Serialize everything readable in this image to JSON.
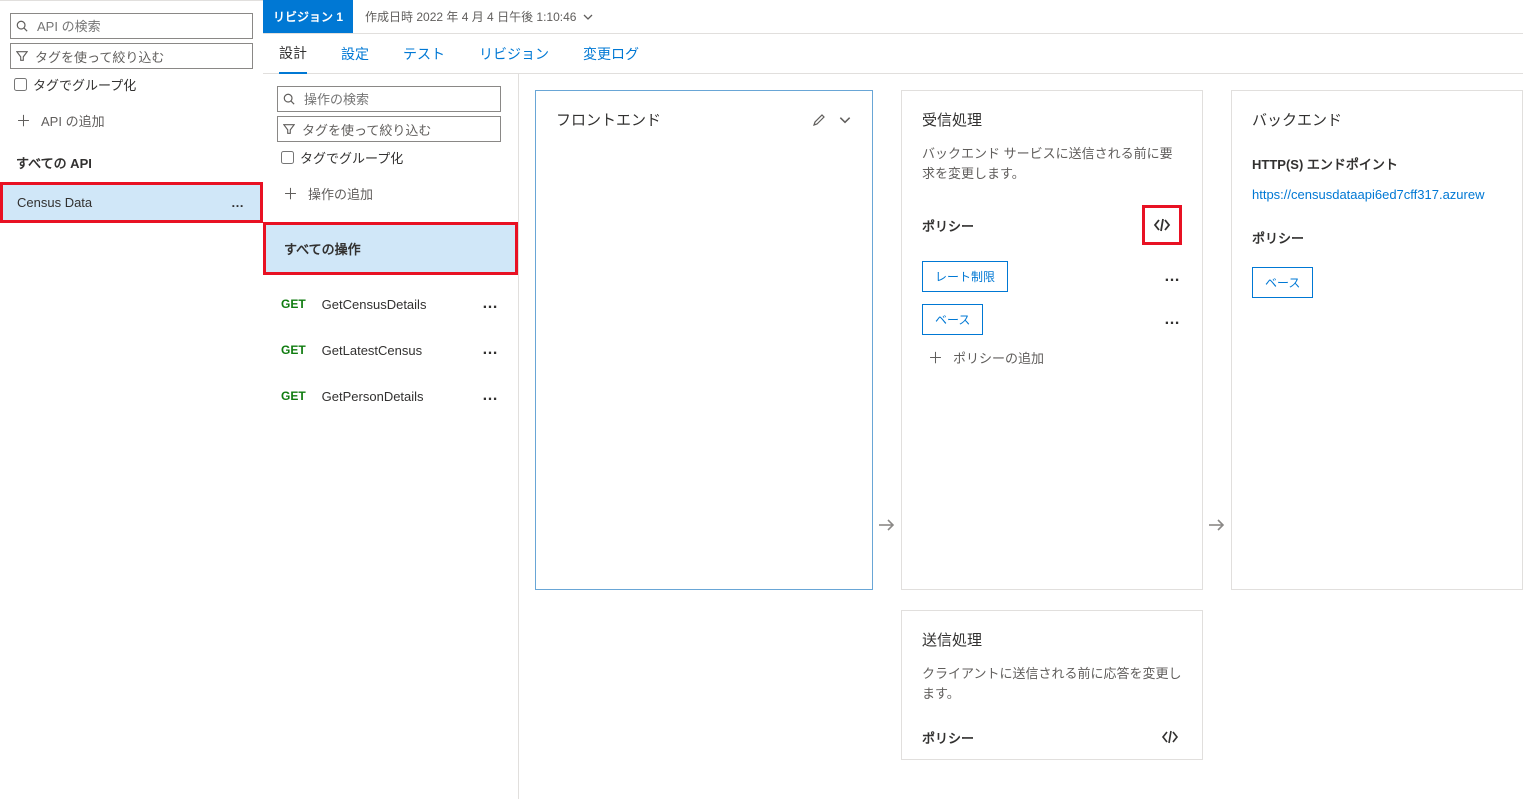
{
  "left": {
    "search_placeholder": "API の検索",
    "filter_text": "タグを使って絞り込む",
    "group_by_tag": "タグでグループ化",
    "add_api": "API の追加",
    "all_apis": "すべての API",
    "api_name": "Census Data"
  },
  "topbar": {
    "revision_badge": "リビジョン 1",
    "created_text": "作成日時 2022 年 4 月 4 日午後 1:10:46"
  },
  "tabs": {
    "design": "設計",
    "settings": "設定",
    "test": "テスト",
    "revisions": "リビジョン",
    "changelog": "変更ログ"
  },
  "ops": {
    "search_placeholder": "操作の検索",
    "filter_text": "タグを使って絞り込む",
    "group_by_tag": "タグでグループ化",
    "add_operation": "操作の追加",
    "all_operations": "すべての操作",
    "items": [
      {
        "method": "GET",
        "name": "GetCensusDetails"
      },
      {
        "method": "GET",
        "name": "GetLatestCensus"
      },
      {
        "method": "GET",
        "name": "GetPersonDetails"
      }
    ]
  },
  "frontend": {
    "title": "フロントエンド"
  },
  "inbound": {
    "title": "受信処理",
    "desc": "バックエンド サービスに送信される前に要求を変更します。",
    "policy_label": "ポリシー",
    "rate_limit": "レート制限",
    "base": "ベース",
    "add_policy": "ポリシーの追加"
  },
  "outbound": {
    "title": "送信処理",
    "desc": "クライアントに送信される前に応答を変更します。",
    "policy_label": "ポリシー"
  },
  "backend": {
    "title": "バックエンド",
    "endpoint_label": "HTTP(S) エンドポイント",
    "endpoint_url": "https://censusdataapi6ed7cff317.azurew",
    "policy_label": "ポリシー",
    "base": "ベース"
  }
}
